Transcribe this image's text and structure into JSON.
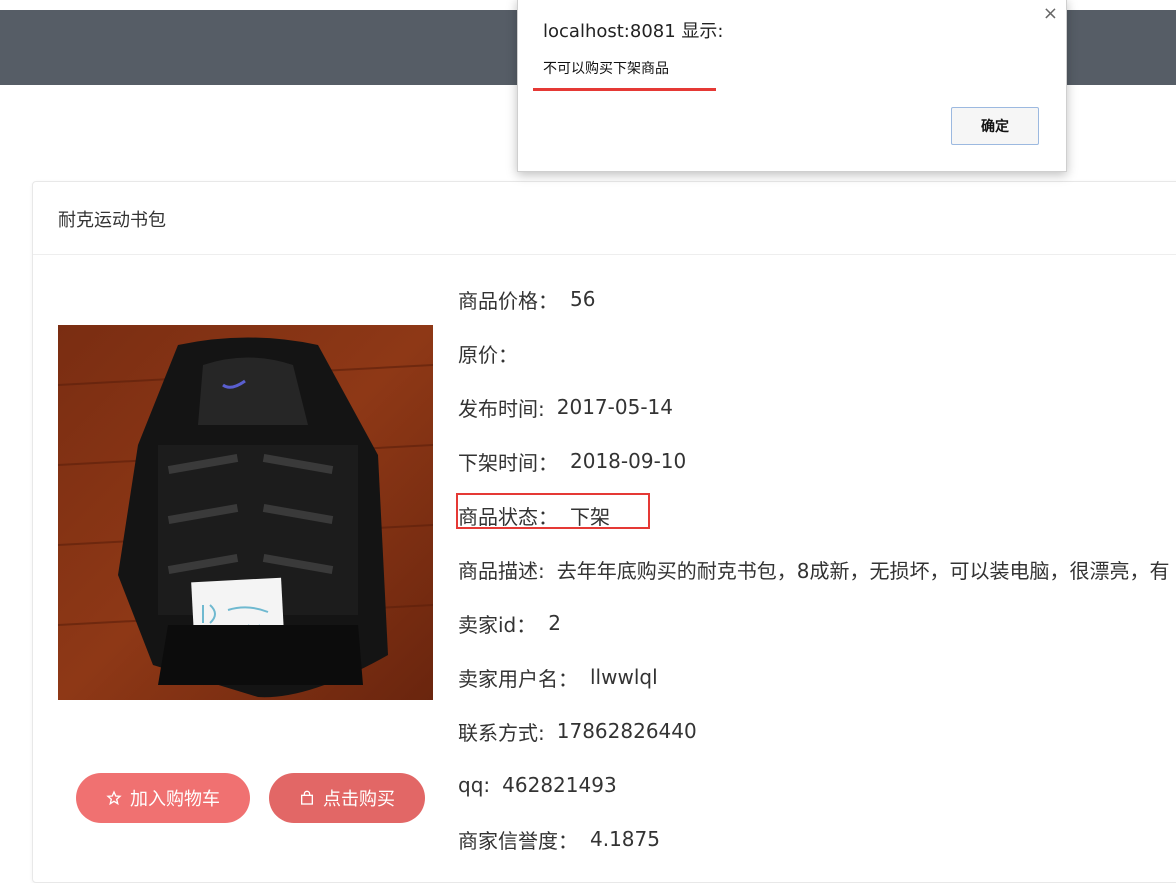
{
  "product": {
    "title": "耐克运动书包",
    "image_alt": "backpack-photo"
  },
  "info": [
    {
      "label": "商品价格：",
      "value": "56"
    },
    {
      "label": "原价：",
      "value": ""
    },
    {
      "label": "发布时间:",
      "value": "2017-05-14"
    },
    {
      "label": "下架时间：",
      "value": "2018-09-10"
    },
    {
      "label": "商品状态：",
      "value": "下架"
    },
    {
      "label": "商品描述:",
      "value": "去年年底购买的耐克书包，8成新，无损坏，可以装电脑，很漂亮，有"
    },
    {
      "label": "卖家id：",
      "value": "2"
    },
    {
      "label": "卖家用户名：",
      "value": "llwwlql"
    },
    {
      "label": "联系方式:",
      "value": "17862826440"
    },
    {
      "label": "qq:",
      "value": "462821493"
    },
    {
      "label": "商家信誉度：",
      "value": "4.1875"
    }
  ],
  "buttons": {
    "add_to_cart": "加入购物车",
    "buy_now": "点击购买"
  },
  "dialog": {
    "title": "localhost:8081 显示:",
    "message": "不可以购买下架商品",
    "ok_label": "确定",
    "close_glyph": "×"
  },
  "icons": {
    "cart_icon": "star-outline-icon",
    "buy_icon": "shopping-bag-icon"
  },
  "colors": {
    "navbar": "#565d66",
    "button_cart": "#f07171",
    "button_buy": "#e26766",
    "highlight": "#e53935"
  }
}
